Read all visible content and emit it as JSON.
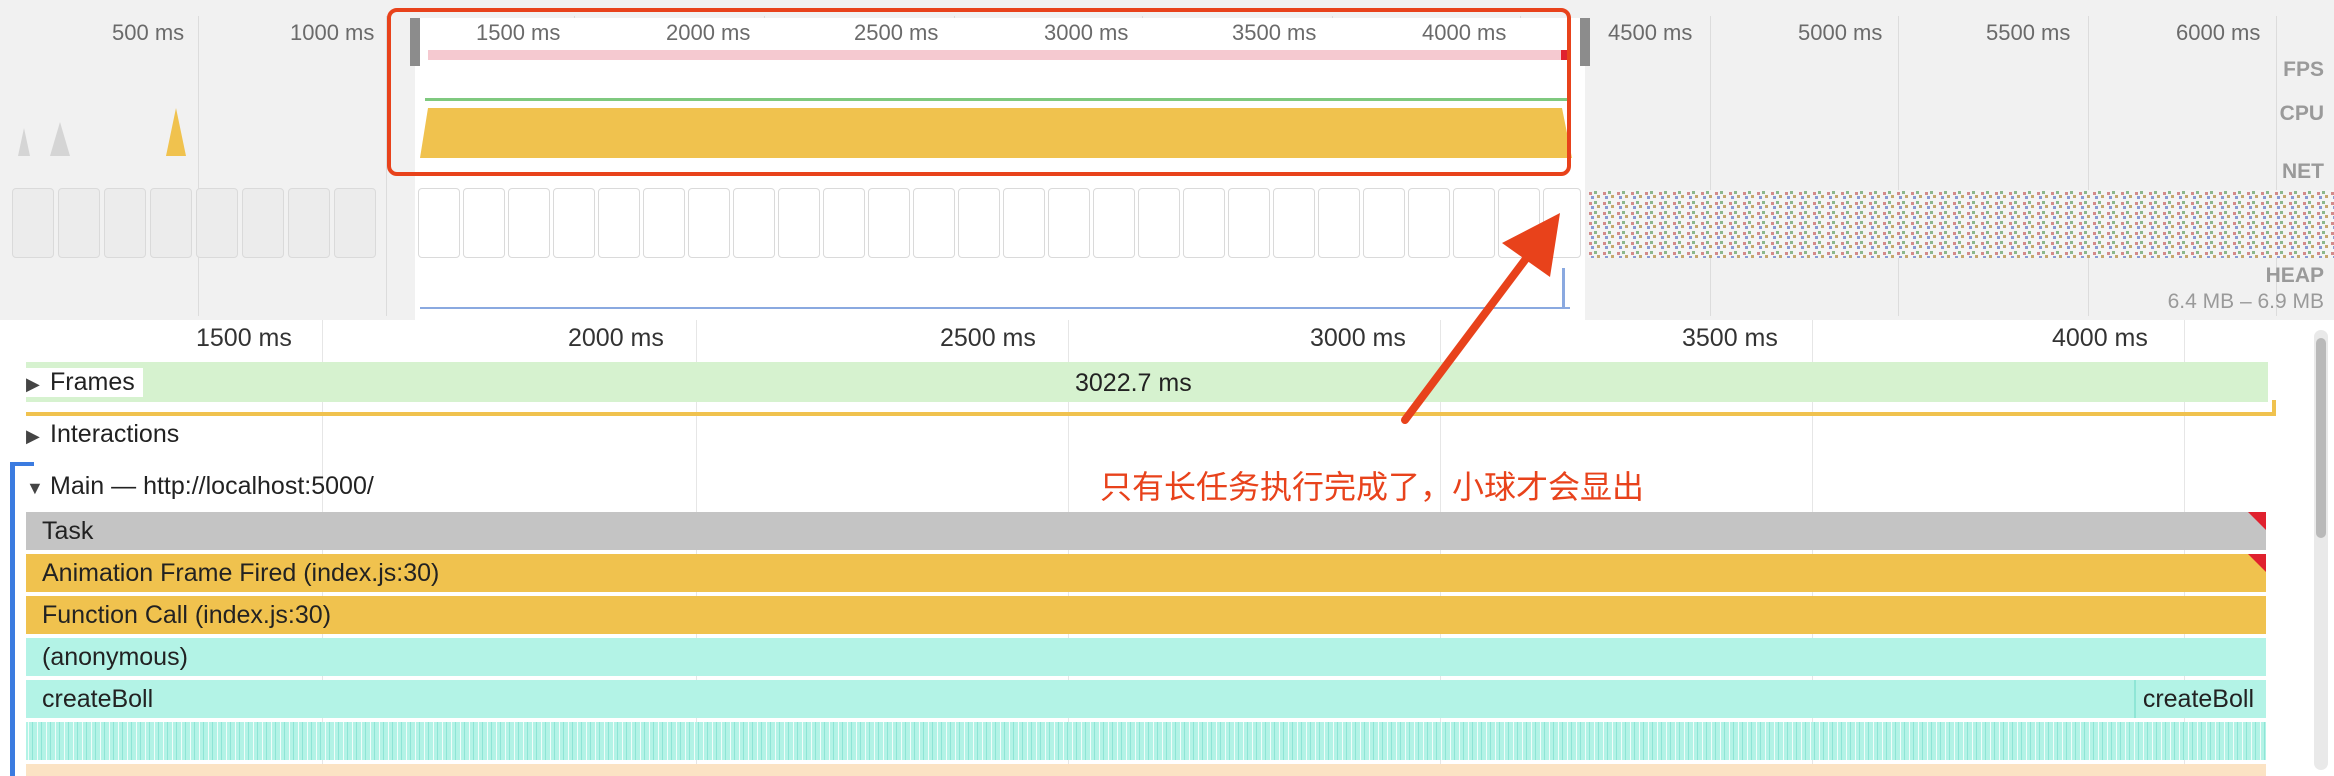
{
  "overview": {
    "ticks": [
      "500 ms",
      "1000 ms",
      "1500 ms",
      "2000 ms",
      "2500 ms",
      "3000 ms",
      "3500 ms",
      "4000 ms",
      "4500 ms",
      "5000 ms",
      "5500 ms",
      "6000 ms"
    ],
    "tracks": {
      "fps": "FPS",
      "cpu": "CPU",
      "net": "NET",
      "heap": "HEAP"
    },
    "heap_range": "6.4 MB – 6.9 MB",
    "colors": {
      "cpu": "#f0c24e",
      "fps": "#f5c9d0",
      "annotation": "#e8421b"
    }
  },
  "timeline": {
    "ticks": [
      "1500 ms",
      "2000 ms",
      "2500 ms",
      "3000 ms",
      "3500 ms",
      "4000 ms"
    ],
    "frames": {
      "label": "Frames",
      "duration": "3022.7 ms"
    },
    "interactions": {
      "label": "Interactions"
    },
    "main": {
      "label": "Main — http://localhost:5000/"
    },
    "events": {
      "task": "Task",
      "anim": "Animation Frame Fired (index.js:30)",
      "func": "Function Call (index.js:30)",
      "anon": "(anonymous)",
      "boll": "createBoll",
      "boll_right": "createBoll"
    }
  },
  "annotation": {
    "text": "只有长任务执行完成了，小球才会显出"
  }
}
